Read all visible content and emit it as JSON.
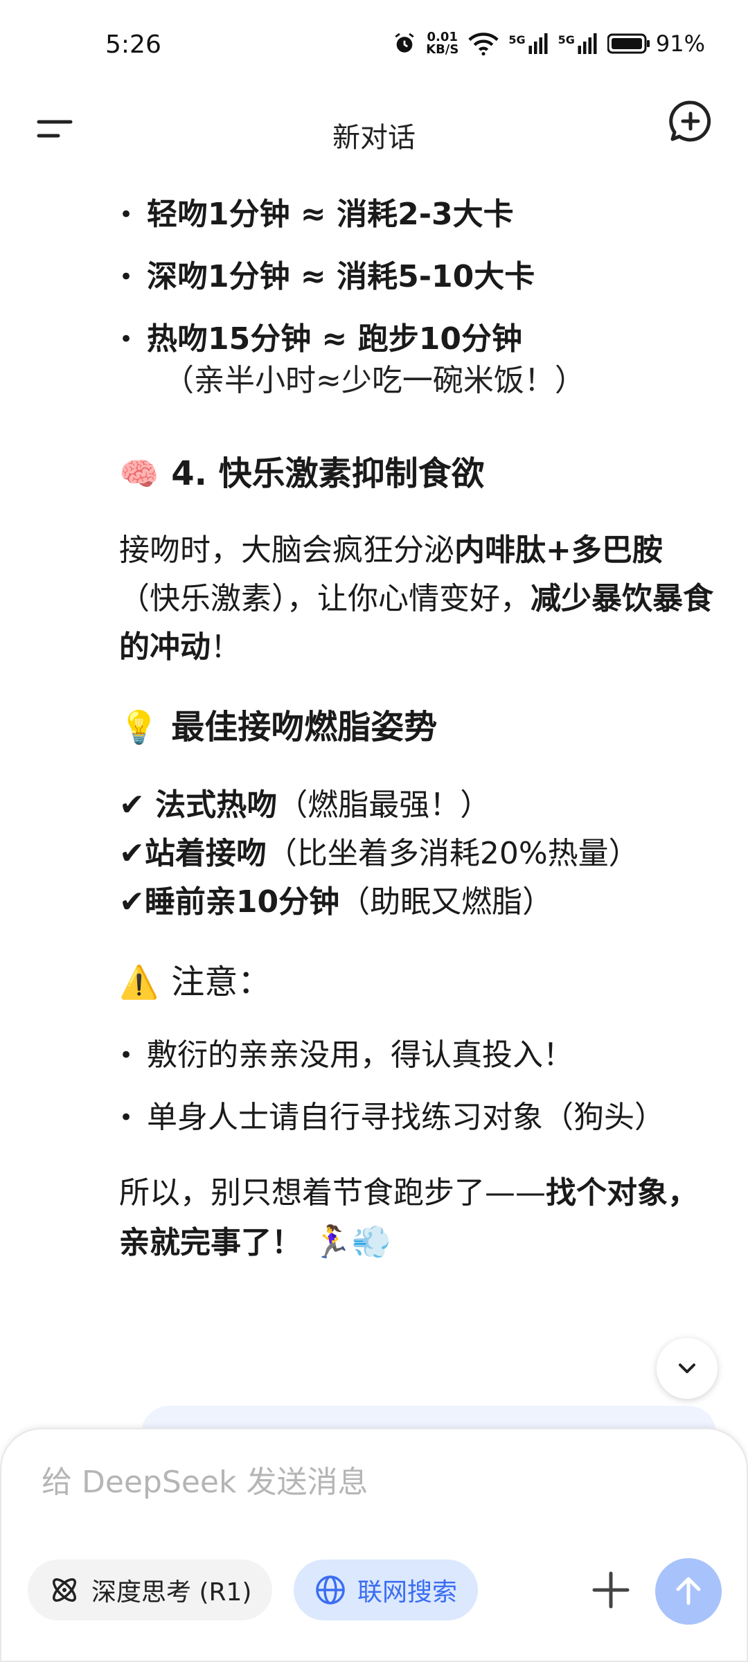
{
  "status_bar": {
    "time": "5:26",
    "net_speed_value": "0.01",
    "net_speed_unit": "KB/S",
    "signal1": "5G",
    "signal2": "5G",
    "battery": "91%"
  },
  "header": {
    "title": "新对话"
  },
  "content": {
    "bullets_top": [
      {
        "bold": "轻吻1分钟 ≈ 消耗2-3大卡",
        "note": ""
      },
      {
        "bold": "深吻1分钟 ≈ 消耗5-10大卡",
        "note": ""
      },
      {
        "bold": "热吻15分钟 ≈ 跑步10分钟",
        "note": "（亲半小时≈少吃一碗米饭！）"
      }
    ],
    "section4": {
      "emoji": "🧠",
      "title": "4. 快乐激素抑制食欲"
    },
    "para1": {
      "t1": "接吻时，大脑会疯狂分泌",
      "b1": "内啡肽+多巴胺",
      "t2": "（快乐激素），让你心情变好，",
      "b2": "减少暴饮暴食的冲动",
      "t3": "！"
    },
    "tips": {
      "emoji": "💡",
      "title": "最佳接吻燃脂姿势"
    },
    "checks": [
      {
        "mark": "✔",
        "bold": " 法式热吻",
        "text": "（燃脂最强！）"
      },
      {
        "mark": "✔",
        "bold": "站着接吻",
        "text": "（比坐着多消耗20%热量）"
      },
      {
        "mark": "✔",
        "bold": "睡前亲10分钟",
        "text": "（助眠又燃脂）"
      }
    ],
    "warning": {
      "emoji": "⚠️",
      "title": "注意："
    },
    "bullets_bottom": [
      "敷衍的亲亲没用，得认真投入！",
      "单身人士请自行寻找练习对象（狗头）"
    ],
    "conclusion": {
      "t1": "所以，别只想着节食跑步了——",
      "b1": "找个对象，亲就完事了！",
      "emoji": " 🏃‍♀️💨"
    }
  },
  "composer": {
    "placeholder": "给 DeepSeek 发送消息",
    "deep_think_label": "深度思考 (R1)",
    "web_search_label": "联网搜索",
    "accent_color": "#3b6df0",
    "send_color": "#a8c2fb"
  },
  "icons": {
    "menu": "menu-icon",
    "new_chat": "new-chat-icon",
    "scroll_down": "chevron-down-icon",
    "think": "atom-icon",
    "search": "globe-icon",
    "plus": "plus-icon",
    "send": "arrow-up-icon"
  }
}
